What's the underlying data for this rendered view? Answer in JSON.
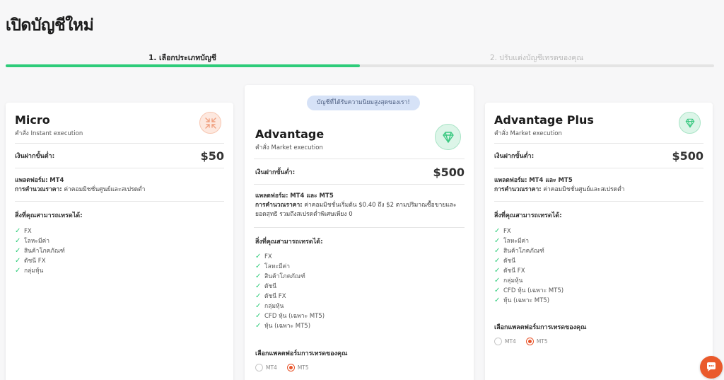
{
  "page": {
    "title": "เปิดบัญชีใหม่"
  },
  "stepper": {
    "steps": [
      {
        "label": "1. เลือกประเภทบัญชี",
        "active": true
      },
      {
        "label": "2. ปรับแต่งบัญชีเทรดของคุณ",
        "active": false
      }
    ],
    "progress_percent": 50,
    "accent_color": "#2ecc7a"
  },
  "cards": [
    {
      "name": "Micro",
      "execution": "คำสั่ง Instant execution",
      "icon": "compress-arrows-icon",
      "deposit_label": "เงินฝากขั้นต่ำ:",
      "deposit_value": "$50",
      "platform_label": "แพลตฟอร์ม:",
      "platform_value": "MT4",
      "pricing_label": "การคำนวณราคา:",
      "pricing_value": "ค่าคอมมิชชั่นศูนย์และสเปรดต่ำ",
      "instruments_title": "สิ่งที่คุณสามารถเทรดได้:",
      "instruments": [
        "FX",
        "โลหะมีค่า",
        "สินค้าโภคภัณฑ์",
        "ดัชนี FX",
        "กลุ่มหุ้น"
      ]
    },
    {
      "badge": "บัญชีที่ได้รับความนิยมสูงสุดของเรา!",
      "name": "Advantage",
      "execution": "คำสั่ง Market execution",
      "icon": "diamond-icon",
      "deposit_label": "เงินฝากขั้นต่ำ:",
      "deposit_value": "$500",
      "platform_label": "แพลตฟอร์ม:",
      "platform_value": "MT4 และ MT5",
      "pricing_label": "การคำนวณราคา:",
      "pricing_value": "ค่าคอมมิชชั่นเริ่มต้น $0.40 ถึง $2 ตามปริมาณซื้อขายและยอดสุทธิ รวมถึงสเปรดต่ำพิเศษเพียง 0",
      "instruments_title": "สิ่งที่คุณสามารถเทรดได้:",
      "instruments": [
        "FX",
        "โลหะมีค่า",
        "สินค้าโภคภัณฑ์",
        "ดัชนี",
        "ดัชนี FX",
        "กลุ่มหุ้น",
        "CFD หุ้น (เฉพาะ MT5)",
        "หุ้น (เฉพาะ MT5)"
      ],
      "platform_select_title": "เลือกแพลตฟอร์มการเทรดของคุณ",
      "platform_options": [
        "MT4",
        "MT5"
      ],
      "platform_selected": "MT5"
    },
    {
      "name": "Advantage Plus",
      "execution": "คำสั่ง Market execution",
      "icon": "diamond-icon",
      "deposit_label": "เงินฝากขั้นต่ำ:",
      "deposit_value": "$500",
      "platform_label": "แพลตฟอร์ม:",
      "platform_value": "MT4 และ MT5",
      "pricing_label": "การคำนวณราคา:",
      "pricing_value": "ค่าคอมมิชชั่นศูนย์และสเปรดต่ำ",
      "instruments_title": "สิ่งที่คุณสามารถเทรดได้:",
      "instruments": [
        "FX",
        "โลหะมีค่า",
        "สินค้าโภคภัณฑ์",
        "ดัชนี",
        "ดัชนี FX",
        "กลุ่มหุ้น",
        "CFD หุ้น (เฉพาะ MT5)",
        "หุ้น (เฉพาะ MT5)"
      ],
      "platform_select_title": "เลือกแพลตฟอร์มการเทรดของคุณ",
      "platform_options": [
        "MT4",
        "MT5"
      ],
      "platform_selected": "MT5"
    }
  ],
  "chat": {
    "icon": "chat-bubble-icon",
    "color": "#ea5a2c"
  }
}
